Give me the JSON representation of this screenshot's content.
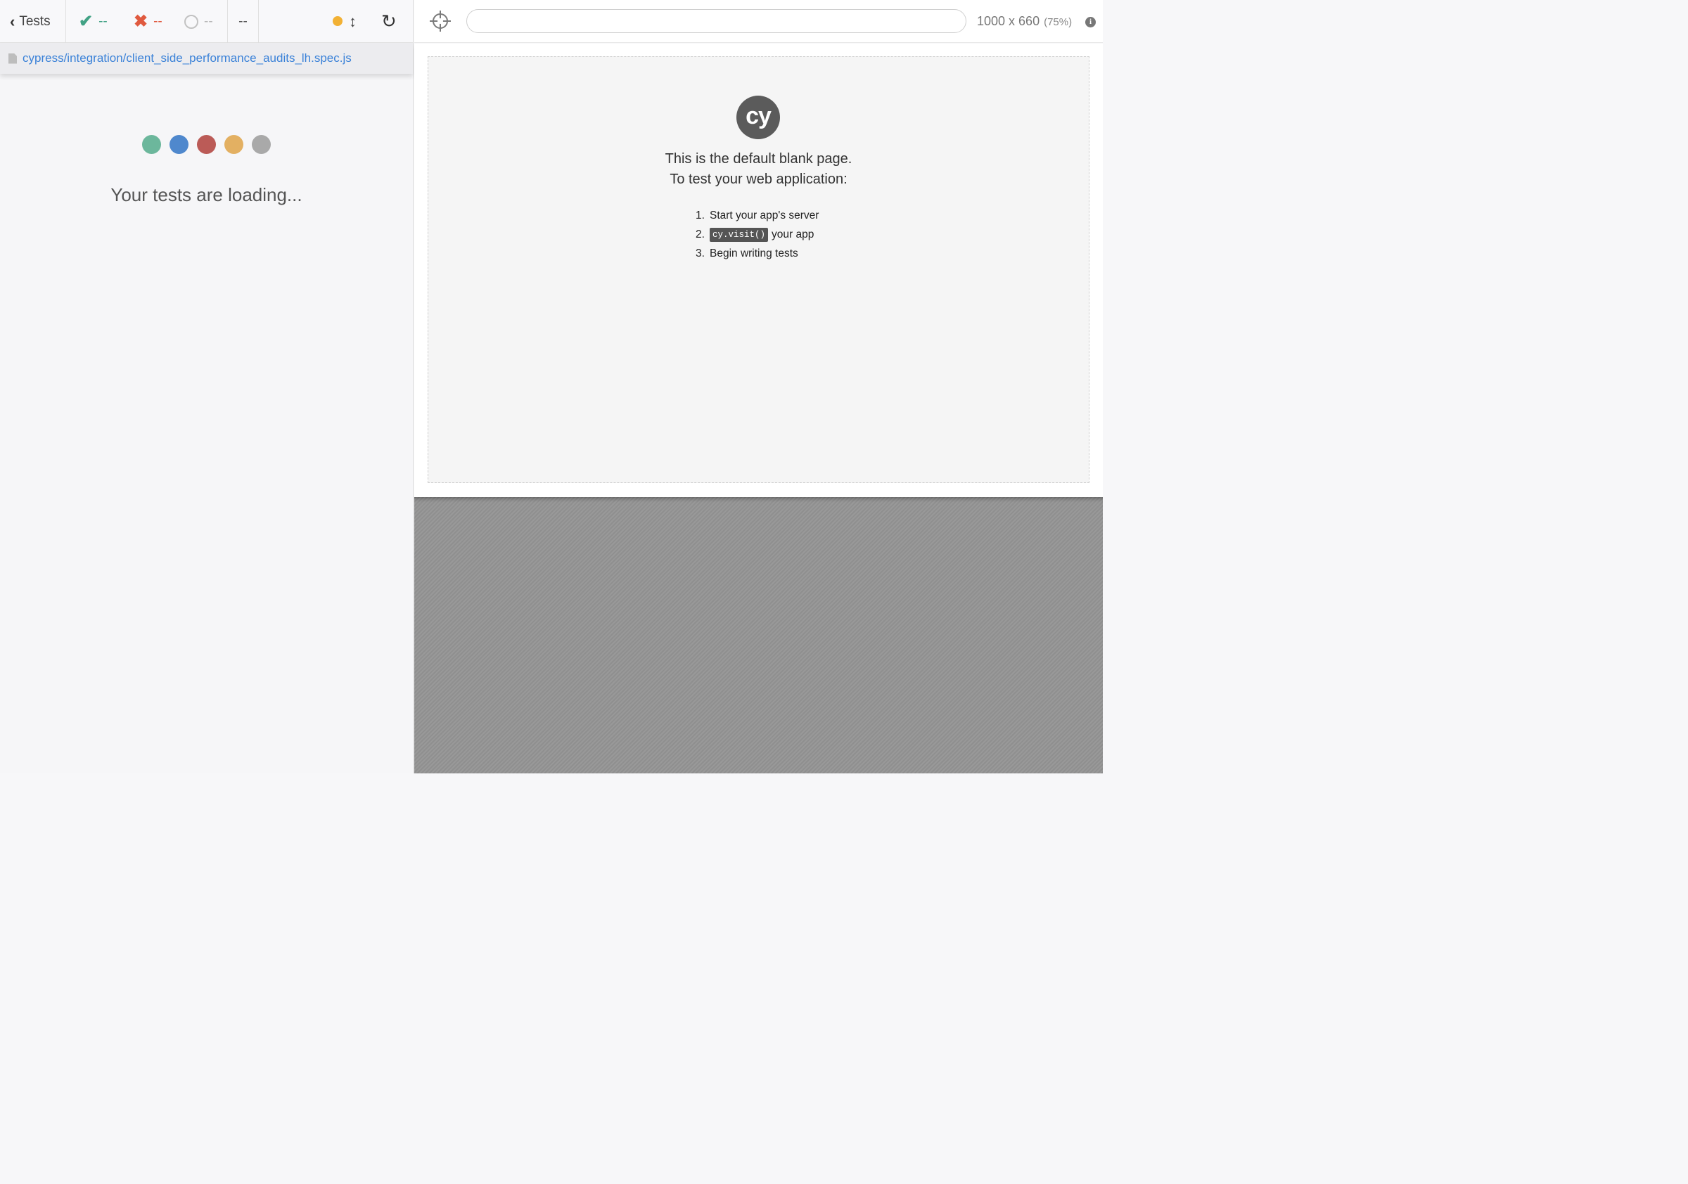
{
  "reporter": {
    "back_label": "Tests",
    "stats": {
      "passed": "--",
      "failed": "--",
      "pending": "--",
      "duration": "--"
    },
    "spec_path": "cypress/integration/client_side_performance_audits_lh.spec.js",
    "loading_text": "Your tests are loading...",
    "loader_dot_colors": [
      "#6cb79c",
      "#4f88cd",
      "#bb5b57",
      "#e3b062",
      "#a9a9a9"
    ]
  },
  "aut": {
    "url": "",
    "viewport_size": "1000 x 660",
    "viewport_scale": "(75%)",
    "blank_page": {
      "logo_text": "cy",
      "line1": "This is the default blank page.",
      "line2": "To test your web application:",
      "steps": [
        {
          "num": "1.",
          "code": "",
          "text": "Start your app's server"
        },
        {
          "num": "2.",
          "code": "cy.visit()",
          "text": "your app"
        },
        {
          "num": "3.",
          "code": "",
          "text": "Begin writing tests"
        }
      ]
    }
  },
  "icons": {
    "back": "chevron-left-icon",
    "passed": "check-icon",
    "failed": "x-icon",
    "pending": "circle-notch-icon",
    "running_indicator": "status-dot-icon",
    "autoscroll": "arrows-vertical-icon",
    "reload": "redo-icon",
    "selector_playground": "crosshairs-icon",
    "file": "file-icon",
    "info": "info-circle-icon"
  },
  "colors": {
    "pass": "#42a285",
    "fail": "#e05a3f",
    "link": "#3b82d8",
    "running": "#f2b134"
  }
}
